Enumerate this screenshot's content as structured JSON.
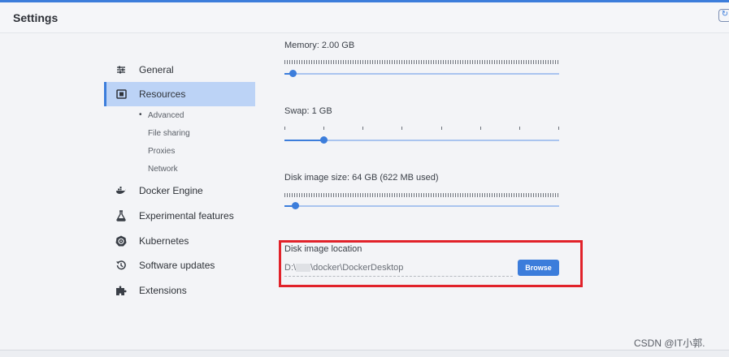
{
  "header": {
    "title": "Settings"
  },
  "nav": {
    "items": [
      {
        "label": "General",
        "icon": "sliders-icon"
      },
      {
        "label": "Resources",
        "icon": "resources-icon"
      },
      {
        "label": "Docker Engine",
        "icon": "whale-icon"
      },
      {
        "label": "Experimental features",
        "icon": "flask-icon"
      },
      {
        "label": "Kubernetes",
        "icon": "kubernetes-icon"
      },
      {
        "label": "Software updates",
        "icon": "history-icon"
      },
      {
        "label": "Extensions",
        "icon": "puzzle-icon"
      }
    ],
    "sub_items": [
      "Advanced",
      "File sharing",
      "Proxies",
      "Network"
    ]
  },
  "resources": {
    "memory_label": "Memory: 2.00 GB",
    "memory_level": 0.03,
    "swap_label": "Swap: 1 GB",
    "swap_level": 0.143,
    "disk_size_label": "Disk image size: 64 GB (622 MB used)",
    "disk_size_level": 0.04,
    "disk_location_label": "Disk image location",
    "disk_location_prefix": "D:\\",
    "disk_location_suffix": "\\docker\\DockerDesktop",
    "browse_label": "Browse"
  },
  "watermark": "CSDN @IT小郭.",
  "colors": {
    "accent": "#3c7ddb",
    "active_bg": "#bcd3f6",
    "highlight": "#e1222a"
  }
}
